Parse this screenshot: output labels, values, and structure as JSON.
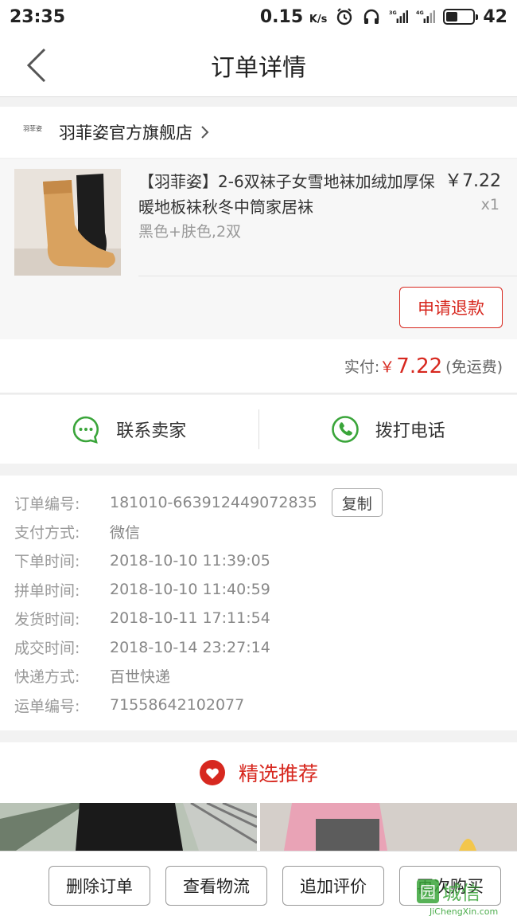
{
  "status_bar": {
    "time": "23:35",
    "speed": "0.15",
    "speed_unit": "K/s",
    "net1": "3G",
    "net2": "4G",
    "battery_level": 42,
    "battery_text": "42"
  },
  "nav": {
    "title": "订单详情"
  },
  "shop": {
    "logo_text": "羽菲姿",
    "name": "羽菲姿官方旗舰店"
  },
  "product": {
    "title": "【羽菲姿】2-6双袜子女雪地袜加绒加厚保暖地板袜秋冬中筒家居袜",
    "price": "￥7.22",
    "quantity": "x1",
    "sku": "黑色+肤色,2双",
    "refund_label": "申请退款"
  },
  "payment": {
    "label": "实付:",
    "currency": "￥",
    "amount": "7.22",
    "shipping_note": "(免运费)"
  },
  "contact": {
    "seller_label": "联系卖家",
    "call_label": "拨打电话"
  },
  "order_info": {
    "copy_label": "复制",
    "rows": [
      {
        "key": "订单编号:",
        "value": "181010-663912449072835"
      },
      {
        "key": "支付方式:",
        "value": "微信"
      },
      {
        "key": "下单时间:",
        "value": "2018-10-10 11:39:05"
      },
      {
        "key": "拼单时间:",
        "value": "2018-10-10 11:40:59"
      },
      {
        "key": "发货时间:",
        "value": "2018-10-11 17:11:54"
      },
      {
        "key": "成交时间:",
        "value": "2018-10-14 23:27:14"
      },
      {
        "key": "快递方式:",
        "value": "百世快递"
      },
      {
        "key": "运单编号:",
        "value": "71558642102077"
      }
    ]
  },
  "recommend": {
    "title": "精选推荐"
  },
  "bottom_actions": [
    {
      "label": "删除订单"
    },
    {
      "label": "查看物流"
    },
    {
      "label": "追加评价"
    },
    {
      "label": "再次购买"
    }
  ],
  "watermark": {
    "brand": "城信",
    "url": "JiChengXin.com"
  },
  "colors": {
    "accent_red": "#d7281f",
    "wechat_green": "#3aa53a"
  }
}
